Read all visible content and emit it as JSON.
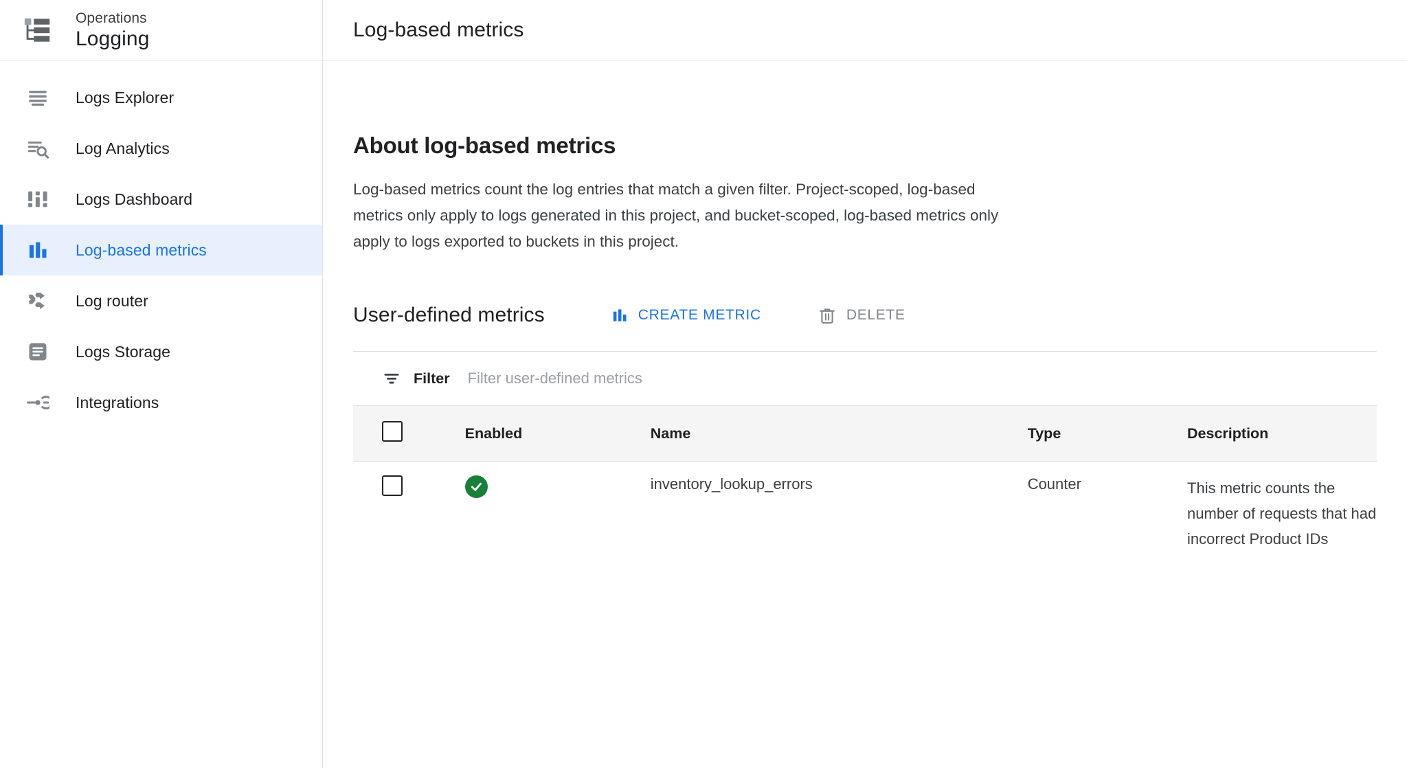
{
  "brand": {
    "suite": "Operations",
    "product": "Logging",
    "logo_icon": "logging-hierarchy-icon"
  },
  "sidebar": {
    "items": [
      {
        "label": "Logs Explorer",
        "icon": "list-lines-icon",
        "active": false
      },
      {
        "label": "Log Analytics",
        "icon": "list-search-icon",
        "active": false
      },
      {
        "label": "Logs Dashboard",
        "icon": "dashboard-bars-icon",
        "active": false
      },
      {
        "label": "Log-based metrics",
        "icon": "bar-chart-icon",
        "active": true
      },
      {
        "label": "Log router",
        "icon": "shuffle-arrows-icon",
        "active": false
      },
      {
        "label": "Logs Storage",
        "icon": "storage-document-icon",
        "active": false
      },
      {
        "label": "Integrations",
        "icon": "integration-node-icon",
        "active": false
      }
    ]
  },
  "header": {
    "title": "Log-based metrics"
  },
  "about": {
    "heading": "About log-based metrics",
    "body": "Log-based metrics count the log entries that match a given filter. Project-scoped, log-based metrics only apply to logs generated in this project, and bucket-scoped, log-based metrics only apply to logs exported to buckets in this project."
  },
  "user_defined": {
    "title": "User-defined metrics",
    "create_label": "CREATE METRIC",
    "create_icon": "bar-chart-icon",
    "delete_label": "DELETE",
    "delete_icon": "trash-icon"
  },
  "filter": {
    "icon": "filter-icon",
    "label": "Filter",
    "placeholder": "Filter user-defined metrics",
    "value": ""
  },
  "table": {
    "columns": [
      "",
      "Enabled",
      "Name",
      "Type",
      "Description"
    ],
    "rows": [
      {
        "selected": false,
        "enabled": true,
        "enabled_icon": "check-circle-icon",
        "name": "inventory_lookup_errors",
        "type": "Counter",
        "description": "This metric counts the number of requests that had incorrect Product IDs"
      }
    ]
  },
  "colors": {
    "accent_blue": "#1a73e8",
    "active_bg": "#e8f0fe",
    "success_green": "#188038",
    "icon_gray": "#80868b",
    "text_primary": "#202124",
    "text_secondary": "#5f6368"
  }
}
